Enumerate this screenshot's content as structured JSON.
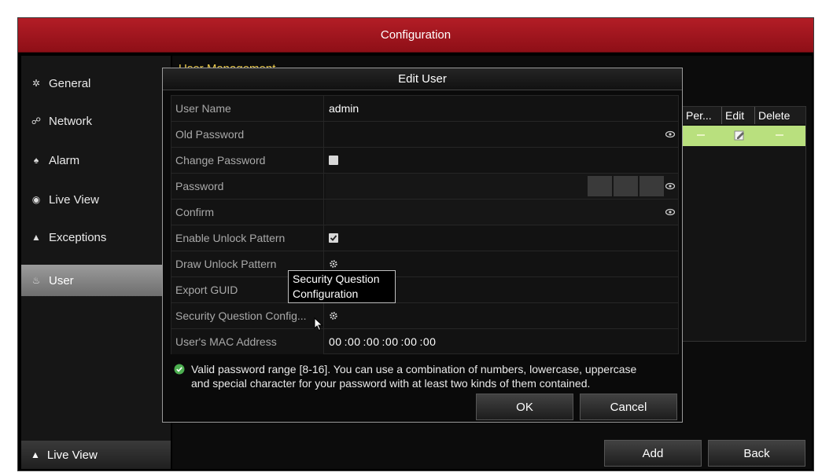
{
  "window": {
    "title": "Configuration"
  },
  "sidebar": {
    "items": [
      {
        "label": "General",
        "icon": "gear-icon"
      },
      {
        "label": "Network",
        "icon": "network-icon"
      },
      {
        "label": "Alarm",
        "icon": "alarm-icon"
      },
      {
        "label": "Live View",
        "icon": "eye-icon"
      },
      {
        "label": "Exceptions",
        "icon": "warning-icon"
      },
      {
        "label": "User",
        "icon": "users-icon",
        "active": true
      }
    ],
    "bottom_button": {
      "label": "Live View",
      "icon": "home-icon"
    }
  },
  "main": {
    "title": "User Management",
    "table": {
      "columns": [
        "Per...",
        "Edit",
        "Delete"
      ],
      "row_color": "#b9e07e"
    },
    "buttons": {
      "add": "Add",
      "back": "Back"
    }
  },
  "dialog": {
    "title": "Edit User",
    "fields": {
      "user_name": {
        "label": "User Name",
        "value": "admin"
      },
      "old_password": {
        "label": "Old Password"
      },
      "change_password": {
        "label": "Change Password",
        "checked": false
      },
      "password": {
        "label": "Password"
      },
      "confirm": {
        "label": "Confirm"
      },
      "enable_unlock_pattern": {
        "label": "Enable Unlock Pattern",
        "checked": true
      },
      "draw_unlock_pattern": {
        "label": "Draw Unlock Pattern"
      },
      "export_guid": {
        "label": "Export GUID"
      },
      "security_question": {
        "label": "Security Question Config..."
      },
      "mac_address": {
        "label": "User's MAC Address",
        "octets": [
          "00",
          ":00",
          ":00",
          ":00",
          ":00",
          ":00"
        ]
      }
    },
    "info_text": "Valid password range [8-16]. You can use a combination of numbers, lowercase, uppercase and special character for your password with at least two kinds of them contained.",
    "buttons": {
      "ok": "OK",
      "cancel": "Cancel"
    },
    "tooltip": {
      "line1": "Security Question",
      "line2": "Configuration"
    }
  },
  "colors": {
    "titlebar": "#a3171f",
    "accent_title": "#e8c84a",
    "valid_icon": "#4caf50"
  }
}
